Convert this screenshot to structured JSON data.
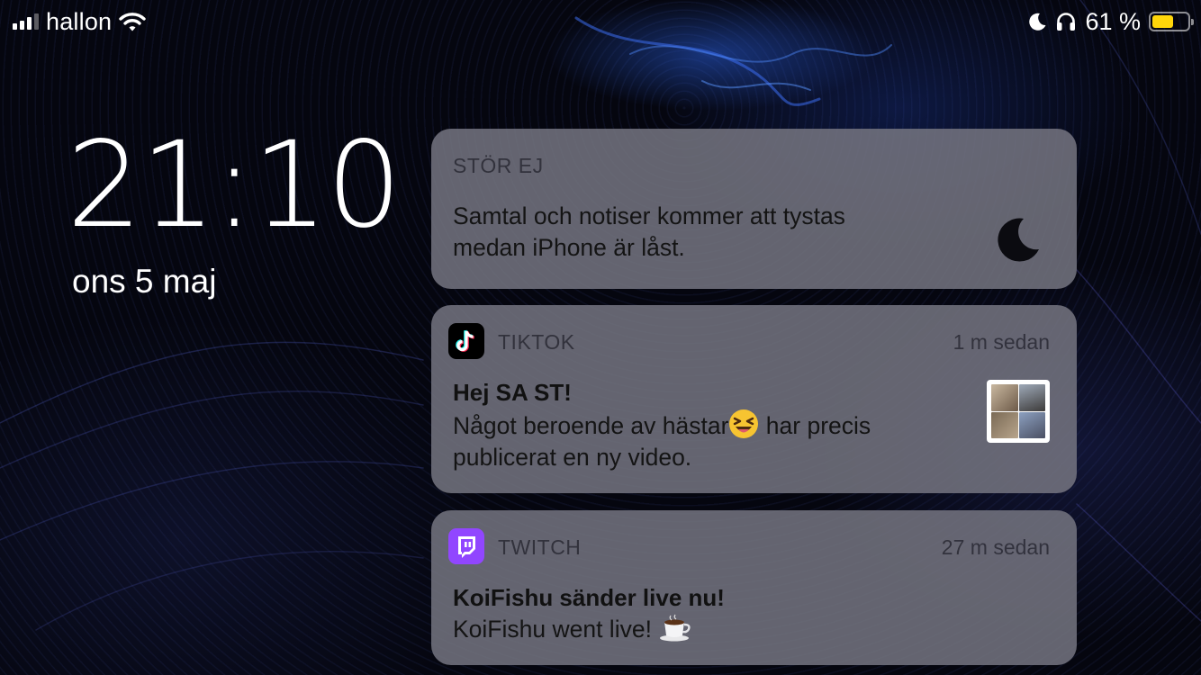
{
  "status_bar": {
    "carrier": "hallon",
    "battery_percent": "61 %",
    "battery_level": 0.61,
    "icons": [
      "cellular-signal-icon",
      "wifi-icon",
      "moon-icon",
      "headphones-icon",
      "battery-icon"
    ]
  },
  "lock_screen": {
    "time": "21:10",
    "date": "ons 5 maj"
  },
  "notifications": {
    "dnd": {
      "app_name": "STÖR EJ",
      "body_line1": "Samtal och notiser kommer att tystas",
      "body_line2": "medan iPhone är låst.",
      "icon": "moon-icon"
    },
    "tiktok": {
      "app_name": "TIKTOK",
      "time_ago": "1 m sedan",
      "title": "Hej SA ST!",
      "body_line1_before": "Något beroende av hästar",
      "body_line1_after": " har precis",
      "body_line2": "publicerat en ny video.",
      "icon": "tiktok-icon"
    },
    "twitch": {
      "app_name": "TWITCH",
      "time_ago": "27 m sedan",
      "title": "KoiFishu sänder live nu!",
      "body": "KoiFishu went live!",
      "icon": "twitch-icon"
    }
  },
  "colors": {
    "card_bg": "#747480",
    "battery": "#ffd60a",
    "twitch": "#9146ff",
    "tiktok_bg": "#000000"
  }
}
